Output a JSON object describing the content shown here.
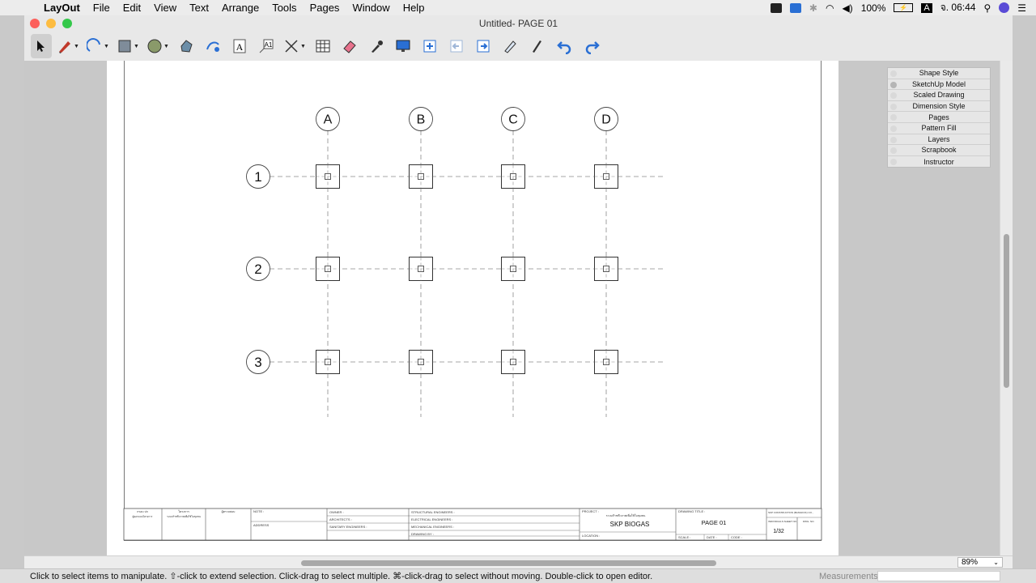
{
  "menubar": {
    "app": "LayOut",
    "items": [
      "File",
      "Edit",
      "View",
      "Text",
      "Arrange",
      "Tools",
      "Pages",
      "Window",
      "Help"
    ],
    "battery": "100%",
    "input_source": "A",
    "clock": "จ. 06:44"
  },
  "window": {
    "title": "Untitled- PAGE 01"
  },
  "toolbar": {
    "tools": [
      "select-tool",
      "line-tool",
      "arc-tool",
      "shape-tool",
      "circle-tool",
      "offset-tool",
      "paint-tool",
      "text-tool",
      "label-tool",
      "dimension-tool",
      "table-tool",
      "eraser-tool",
      "style-tool",
      "presentation-tool",
      "add-page-tool",
      "previous-page-tool",
      "next-page-tool",
      "edit-tool",
      "pen-tool",
      "undo-tool",
      "redo-tool"
    ]
  },
  "grid": {
    "columns": [
      "A",
      "B",
      "C",
      "D"
    ],
    "rows": [
      "1",
      "2",
      "3"
    ]
  },
  "title_block": {
    "col1": "กรอบ ปก",
    "col1_sub": "ผู้ออกแบบโครงการ",
    "col2": "โครงการ",
    "col2_sub": "ระบบก๊าซชีวภาพเพื่อใช้ในชุมชน",
    "col3": "ผู้ตรวจสอบ",
    "note": "NOTE :",
    "address": "ADDRESS",
    "owner": "OWNER :",
    "architects": "ARCHITECTS :",
    "sanitary": "SANITARY  ENGINEERS :",
    "structural": "STRUCTURAL ENGINEERS :",
    "electrical": "ELECTRICAL ENGINEERS :",
    "mechanical": "MECHANICAL  ENGINEERS :",
    "drawing_by": "DRAWING BY :",
    "project_label": "PROJECT :",
    "project_thai": "ระบบก๊าซชีวภาพเพื่อใช้ในชุมชน",
    "project_name": "SKP BIOGAS",
    "location": "LOCATION :",
    "drawing_title_label": "DRAWING TITLE :",
    "drawing_title": "PAGE 01",
    "scale": "SCALE :",
    "date": "DATE :",
    "code": "CODE :",
    "company": "SKP CONSTRUCTION (BANGKOK) CO.,",
    "sheet_label": "INDIVIDUALS SHEET NO.",
    "sheet_number": "1/32",
    "dwg_no": "DWG. NO."
  },
  "trays": [
    "Shape Style",
    "SketchUp Model",
    "Scaled Drawing",
    "Dimension Style",
    "Pages",
    "Pattern Fill",
    "Layers",
    "Scrapbook",
    "Instructor"
  ],
  "zoom": "89%",
  "status": {
    "hint": "Click to select items to manipulate. ⇧-click to extend selection. Click-drag to select multiple. ⌘-click-drag to select without moving. Double-click to open editor.",
    "measurements_label": "Measurements"
  },
  "colors": {
    "close": "#fc605c",
    "minimize": "#fdbc40",
    "zoom": "#34c84a",
    "accent_blue": "#2a6fd4"
  }
}
